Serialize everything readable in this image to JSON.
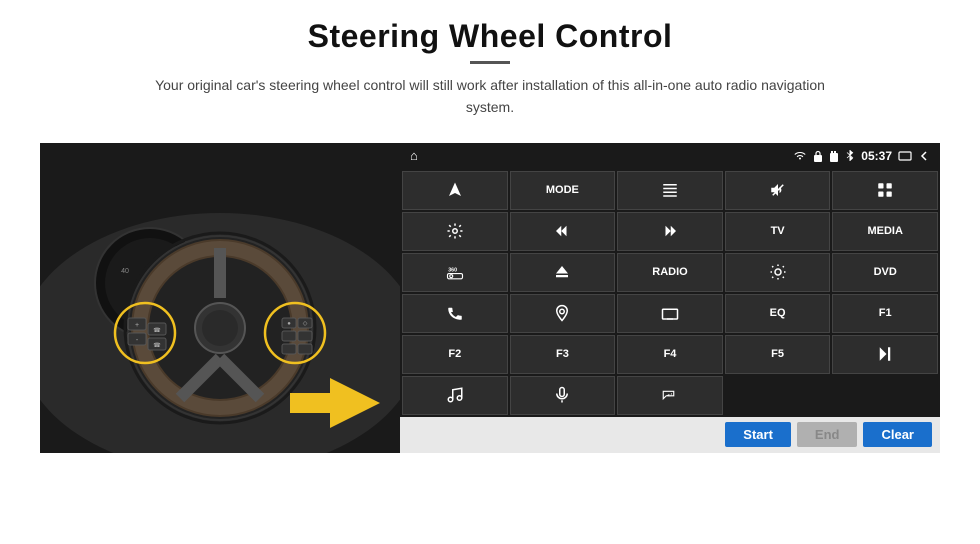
{
  "header": {
    "title": "Steering Wheel Control",
    "divider": true,
    "subtitle": "Your original car's steering wheel control will still work after installation of this all-in-one auto radio navigation system."
  },
  "status_bar": {
    "time": "05:37",
    "home_icon": "⌂",
    "wifi_icon": "wifi",
    "lock_icon": "lock",
    "sd_icon": "sd",
    "bt_icon": "bt",
    "back_icon": "back",
    "window_icon": "win"
  },
  "button_grid": [
    {
      "id": "nav",
      "type": "icon",
      "icon": "navigate"
    },
    {
      "id": "mode",
      "type": "text",
      "label": "MODE"
    },
    {
      "id": "list",
      "type": "icon",
      "icon": "list"
    },
    {
      "id": "mute",
      "type": "icon",
      "icon": "mute"
    },
    {
      "id": "apps",
      "type": "icon",
      "icon": "apps"
    },
    {
      "id": "settings",
      "type": "icon",
      "icon": "settings"
    },
    {
      "id": "prev",
      "type": "icon",
      "icon": "prev"
    },
    {
      "id": "next",
      "type": "icon",
      "icon": "next"
    },
    {
      "id": "tv",
      "type": "text",
      "label": "TV"
    },
    {
      "id": "media",
      "type": "text",
      "label": "MEDIA"
    },
    {
      "id": "cam360",
      "type": "icon",
      "icon": "360cam"
    },
    {
      "id": "eject",
      "type": "icon",
      "icon": "eject"
    },
    {
      "id": "radio",
      "type": "text",
      "label": "RADIO"
    },
    {
      "id": "brightness",
      "type": "icon",
      "icon": "brightness"
    },
    {
      "id": "dvd",
      "type": "text",
      "label": "DVD"
    },
    {
      "id": "phone",
      "type": "icon",
      "icon": "phone"
    },
    {
      "id": "map",
      "type": "icon",
      "icon": "map"
    },
    {
      "id": "rect",
      "type": "icon",
      "icon": "screen"
    },
    {
      "id": "eq",
      "type": "text",
      "label": "EQ"
    },
    {
      "id": "f1",
      "type": "text",
      "label": "F1"
    },
    {
      "id": "f2",
      "type": "text",
      "label": "F2"
    },
    {
      "id": "f3",
      "type": "text",
      "label": "F3"
    },
    {
      "id": "f4",
      "type": "text",
      "label": "F4"
    },
    {
      "id": "f5",
      "type": "text",
      "label": "F5"
    },
    {
      "id": "playpause",
      "type": "icon",
      "icon": "playpause"
    },
    {
      "id": "music",
      "type": "icon",
      "icon": "music"
    },
    {
      "id": "mic",
      "type": "icon",
      "icon": "mic"
    },
    {
      "id": "volphone",
      "type": "icon",
      "icon": "volphone"
    },
    {
      "id": "empty1",
      "type": "empty"
    },
    {
      "id": "empty2",
      "type": "empty"
    }
  ],
  "action_bar": {
    "start_label": "Start",
    "end_label": "End",
    "clear_label": "Clear"
  }
}
